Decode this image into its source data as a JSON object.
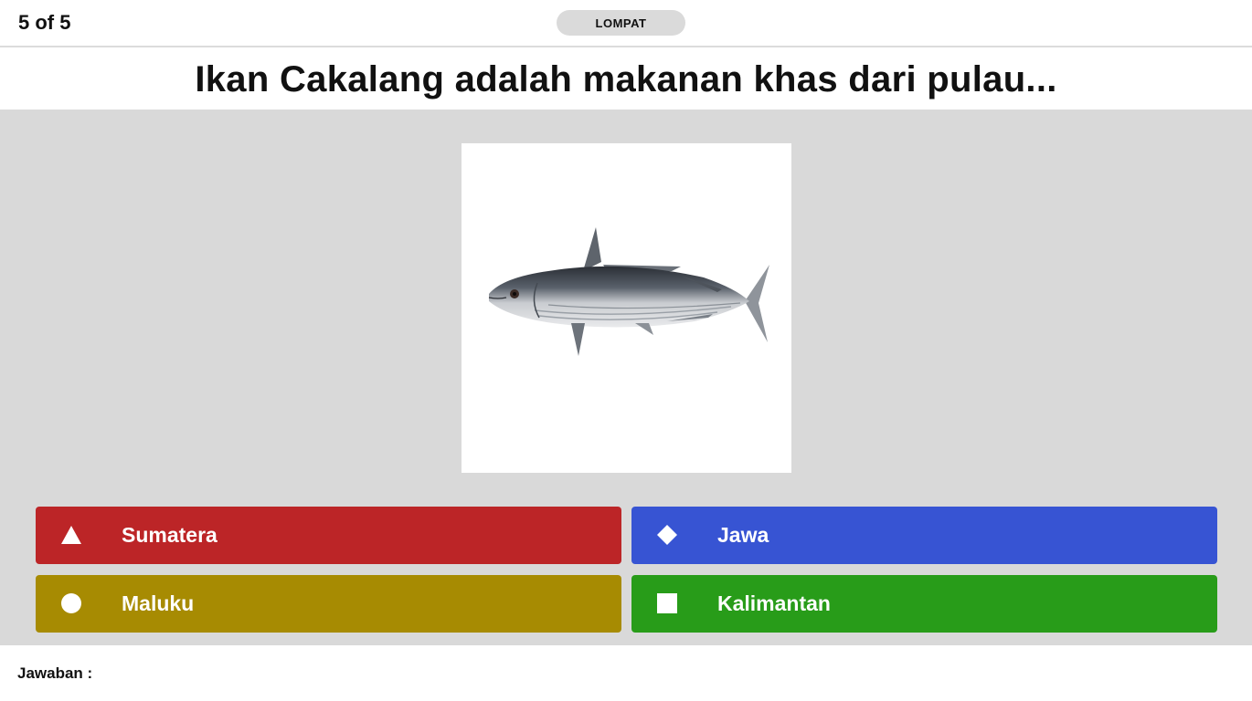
{
  "header": {
    "counter": "5 of 5",
    "skip_label": "LOMPAT"
  },
  "question": {
    "text": "Ikan Cakalang adalah makanan khas dari pulau..."
  },
  "answers": [
    {
      "shape": "triangle-icon",
      "label": "Sumatera",
      "color": "#bc2527"
    },
    {
      "shape": "diamond-icon",
      "label": "Jawa",
      "color": "#3754d3"
    },
    {
      "shape": "circle-icon",
      "label": "Maluku",
      "color": "#a78b02"
    },
    {
      "shape": "square-icon",
      "label": "Kalimantan",
      "color": "#289c19"
    }
  ],
  "footer": {
    "answer_label": "Jawaban :"
  },
  "colors": {
    "stage_background": "#d9d9d9",
    "skip_button": "#dadada"
  }
}
